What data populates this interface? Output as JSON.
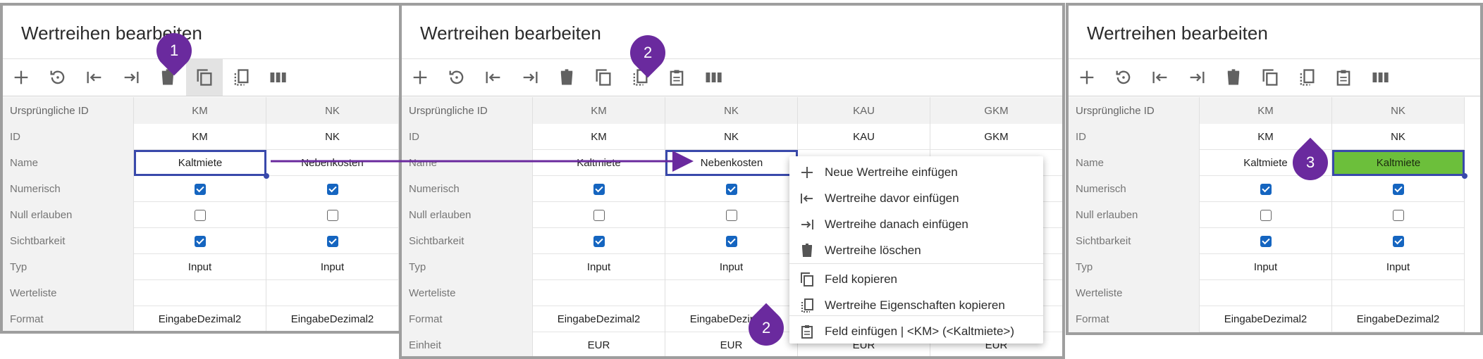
{
  "panels": [
    {
      "title": "Wertreihen bearbeiten",
      "columns": [
        "KM",
        "NK"
      ],
      "rows": [
        {
          "label": "Ursprüngliche ID",
          "cells": [
            "KM",
            "NK"
          ],
          "type": "header"
        },
        {
          "label": "ID",
          "cells": [
            "KM",
            "NK"
          ]
        },
        {
          "label": "Name",
          "cells": [
            "Kaltmiete",
            "Nebenkosten"
          ]
        },
        {
          "label": "Numerisch",
          "checks": [
            true,
            true
          ]
        },
        {
          "label": "Null erlauben",
          "checks": [
            false,
            false
          ]
        },
        {
          "label": "Sichtbarkeit",
          "checks": [
            true,
            true
          ]
        },
        {
          "label": "Typ",
          "cells": [
            "Input",
            "Input"
          ]
        },
        {
          "label": "Werteliste",
          "cells": [
            "",
            ""
          ]
        },
        {
          "label": "Format",
          "cells": [
            "EingabeDezimal2",
            "EingabeDezimal2"
          ]
        }
      ]
    },
    {
      "title": "Wertreihen bearbeiten",
      "rows": [
        {
          "label": "Ursprüngliche ID",
          "cells": [
            "KM",
            "NK",
            "KAU",
            "GKM"
          ],
          "type": "header"
        },
        {
          "label": "ID",
          "cells": [
            "KM",
            "NK",
            "KAU",
            "GKM"
          ]
        },
        {
          "label": "Name",
          "cells": [
            "Kaltmiete",
            "Nebenkosten",
            "",
            ""
          ]
        },
        {
          "label": "Numerisch",
          "checks": [
            true,
            true
          ]
        },
        {
          "label": "Null erlauben",
          "checks": [
            false,
            false
          ]
        },
        {
          "label": "Sichtbarkeit",
          "checks": [
            true,
            true
          ]
        },
        {
          "label": "Typ",
          "cells": [
            "Input",
            "Input",
            "",
            ""
          ]
        },
        {
          "label": "Werteliste",
          "cells": [
            "",
            "",
            "",
            ""
          ]
        },
        {
          "label": "Format",
          "cells": [
            "EingabeDezimal2",
            "EingabeDezimal2",
            "",
            ""
          ]
        },
        {
          "label": "Einheit",
          "cells": [
            "EUR",
            "EUR",
            "EUR",
            "EUR"
          ]
        }
      ]
    },
    {
      "title": "Wertreihen bearbeiten",
      "rows": [
        {
          "label": "Ursprüngliche ID",
          "cells": [
            "KM",
            "NK"
          ],
          "type": "header"
        },
        {
          "label": "ID",
          "cells": [
            "KM",
            "NK"
          ]
        },
        {
          "label": "Name",
          "cells": [
            "Kaltmiete",
            "Kaltmiete"
          ]
        },
        {
          "label": "Numerisch",
          "checks": [
            true,
            true
          ]
        },
        {
          "label": "Null erlauben",
          "checks": [
            false,
            false
          ]
        },
        {
          "label": "Sichtbarkeit",
          "checks": [
            true,
            true
          ]
        },
        {
          "label": "Typ",
          "cells": [
            "Input",
            "Input"
          ]
        },
        {
          "label": "Werteliste",
          "cells": [
            "",
            ""
          ]
        },
        {
          "label": "Format",
          "cells": [
            "EingabeDezimal2",
            "EingabeDezimal2"
          ]
        }
      ]
    }
  ],
  "context_menu": {
    "items": [
      {
        "label": "Neue Wertreihe einfügen",
        "icon": "plus-icon"
      },
      {
        "label": "Wertreihe davor einfügen",
        "icon": "insert-before-icon"
      },
      {
        "label": "Wertreihe danach einfügen",
        "icon": "insert-after-icon"
      },
      {
        "label": "Wertreihe löschen",
        "icon": "trash-icon"
      },
      {
        "label": "Feld kopieren",
        "icon": "copy-icon"
      },
      {
        "label": "Wertreihe Eigenschaften kopieren",
        "icon": "copy-properties-icon"
      },
      {
        "label": "Feld einfügen | <KM> (<Kaltmiete>)",
        "icon": "clipboard-icon"
      }
    ]
  },
  "badges": {
    "b1": "1",
    "b2": "2",
    "b2b": "2",
    "b3": "3"
  },
  "colors": {
    "accent": "#3949ab",
    "badge": "#6a2a9e",
    "green": "#6cbf3b",
    "checkbox": "#1565c0"
  }
}
